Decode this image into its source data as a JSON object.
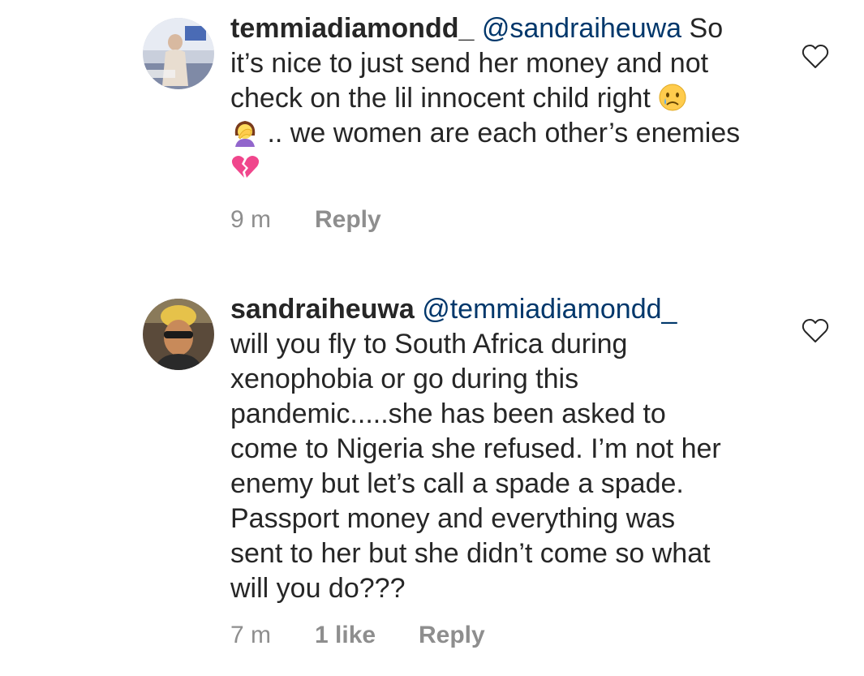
{
  "comments": [
    {
      "username": "temmiadiamondd_",
      "mention": "@sandraiheuwa",
      "lines": [
        "So",
        "it’s nice to just send her money and not",
        "check on the lil innocent child right",
        ".. we women are each other’s enemies"
      ],
      "emojis": [
        "crying-face-icon",
        "facepalm-woman-icon",
        "broken-heart-icon"
      ],
      "time": "9 m",
      "reply_label": "Reply"
    },
    {
      "username": "sandraiheuwa",
      "mention": "@temmiadiamondd_",
      "lines": [
        "will you fly to  South Africa during",
        "xenophobia or go during this",
        "pandemic.....she has been asked to",
        "come to Nigeria she refused. I’m not her",
        "enemy but let’s call a spade a spade.",
        "Passport money and everything was",
        "sent to her but she didn’t come so what",
        "will you do???"
      ],
      "time": "7 m",
      "likes": "1 like",
      "reply_label": "Reply"
    }
  ],
  "colors": {
    "text": "#262626",
    "mention": "#00376b",
    "meta": "#8e8e8e",
    "broken_heart": "#f0468c"
  }
}
